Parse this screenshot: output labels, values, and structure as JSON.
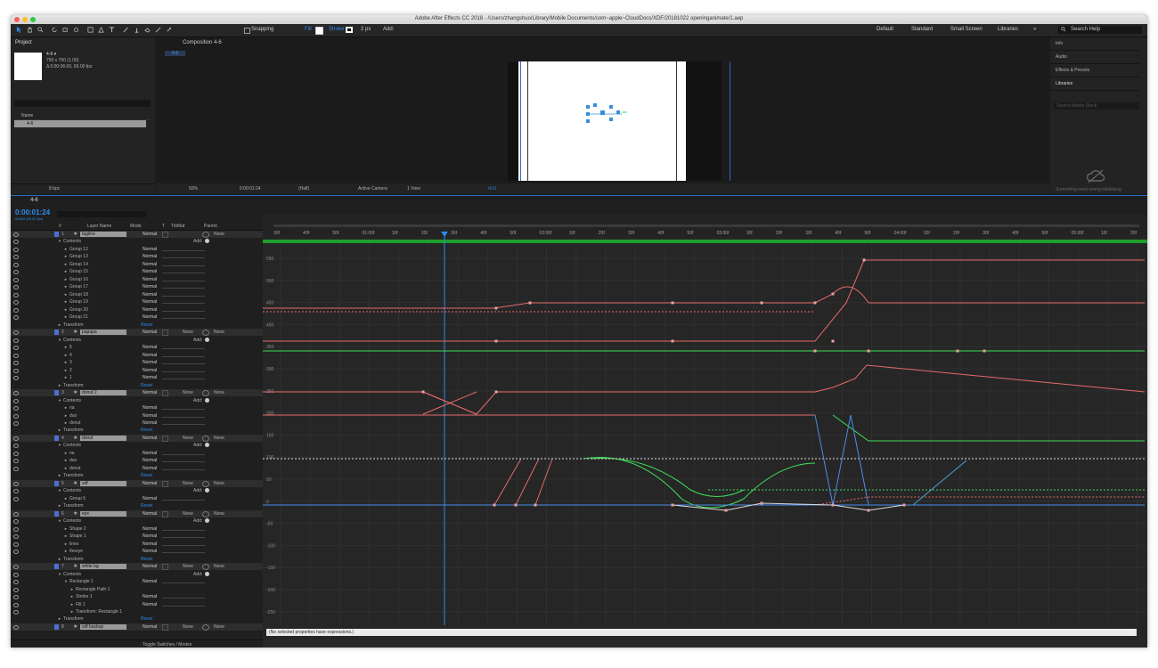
{
  "window": {
    "title": "Adobe After Effects CC 2018 - /Users/zhangshuo/Library/Mobile Documents/com~apple~CloudDocs/XDF/20181022 openinganimate/1.aep"
  },
  "toolbar": {
    "snapping": "Snapping",
    "fill": "Fill",
    "stroke": "Stroke",
    "stroke_width": "2 px",
    "add": "Add:",
    "workspaces": [
      "Default",
      "Standard",
      "Small Screen",
      "Libraries"
    ],
    "search_help": "Search Help"
  },
  "project": {
    "title": "Project",
    "item_name": "4-6 ▾",
    "item_dims": "750 x 750 (1.00)",
    "item_duration": "Δ 0:00:06:00, 60.00 fps",
    "name_header": "Name",
    "list_item": "4-6",
    "bpc": "8 bpc"
  },
  "composition": {
    "tab_label": "Composition 4-6",
    "chip": "4-6",
    "zoom": "50%",
    "timecode": "0:00:01:24",
    "resolution": "(Half)",
    "camera": "Active Camera",
    "view": "1 View",
    "offset": "+0.0"
  },
  "right_panels": [
    "Info",
    "Audio",
    "Effects & Presets",
    "Libraries"
  ],
  "libraries": {
    "search_placeholder": "Search Adobe Stock",
    "error_text": "Something went wrong initializing"
  },
  "timeline": {
    "tab": "4-6",
    "timecode": "0:00:01:24",
    "timecode_sub": "00084 (60.00 fps)",
    "headers": {
      "num": "#",
      "layer_name": "Layer Name",
      "mode": "Mode",
      "t": "T",
      "trkmat": "TrkMat",
      "parent": "Parent"
    },
    "ruler_labels": [
      "30f",
      "40f",
      "50f",
      "01:00f",
      "10f",
      "20f",
      "30f",
      "40f",
      "50f",
      "02:00f",
      "10f",
      "20f",
      "30f",
      "40f",
      "50f",
      "03:00f",
      "10f",
      "20f",
      "30f",
      "40f",
      "50f",
      "04:00f",
      "10f",
      "20f",
      "30f",
      "40f",
      "50f",
      "05:00f",
      "10f",
      "20f"
    ],
    "y_labels": [
      "550",
      "500",
      "450",
      "400",
      "350",
      "300",
      "250",
      "200",
      "150",
      "100",
      "50",
      "0",
      "-50",
      "-100",
      "-150",
      "-200",
      "-250"
    ],
    "expression_message": "(No selected properties have expressions.)",
    "toggle_label": "Toggle Switches / Modes"
  },
  "rows": [
    {
      "type": "layer",
      "num": "1",
      "name": "tagline",
      "mode": "Normal",
      "trkmat": "",
      "parent": "None"
    },
    {
      "type": "group",
      "indent": 1,
      "name": "Contents",
      "add": "Add:"
    },
    {
      "type": "prop",
      "indent": 2,
      "name": "Group 12",
      "mode": "Normal"
    },
    {
      "type": "prop",
      "indent": 2,
      "name": "Group 13",
      "mode": "Normal"
    },
    {
      "type": "prop",
      "indent": 2,
      "name": "Group 14",
      "mode": "Normal"
    },
    {
      "type": "prop",
      "indent": 2,
      "name": "Group 15",
      "mode": "Normal"
    },
    {
      "type": "prop",
      "indent": 2,
      "name": "Group 16",
      "mode": "Normal"
    },
    {
      "type": "prop",
      "indent": 2,
      "name": "Group 17",
      "mode": "Normal"
    },
    {
      "type": "prop",
      "indent": 2,
      "name": "Group 18",
      "mode": "Normal"
    },
    {
      "type": "prop",
      "indent": 2,
      "name": "Group 19",
      "mode": "Normal"
    },
    {
      "type": "prop",
      "indent": 2,
      "name": "Group 20",
      "mode": "Normal"
    },
    {
      "type": "prop",
      "indent": 2,
      "name": "Group 21",
      "mode": "Normal"
    },
    {
      "type": "transform",
      "indent": 1,
      "name": "Transform",
      "reset": "Reset"
    },
    {
      "type": "layer",
      "num": "2",
      "name": "papapa",
      "mode": "Normal",
      "trkmat": "None",
      "parent": "None"
    },
    {
      "type": "group",
      "indent": 1,
      "name": "Contents",
      "add": "Add:"
    },
    {
      "type": "prop",
      "indent": 2,
      "name": "5",
      "mode": "Normal"
    },
    {
      "type": "prop",
      "indent": 2,
      "name": "4",
      "mode": "Normal"
    },
    {
      "type": "prop",
      "indent": 2,
      "name": "3",
      "mode": "Normal"
    },
    {
      "type": "prop",
      "indent": 2,
      "name": "2",
      "mode": "Normal"
    },
    {
      "type": "prop",
      "indent": 2,
      "name": "1",
      "mode": "Normal"
    },
    {
      "type": "transform",
      "indent": 1,
      "name": "Transform",
      "reset": "Reset"
    },
    {
      "type": "layer",
      "num": "3",
      "name": "donut 2",
      "mode": "Normal",
      "trkmat": "None",
      "parent": "None"
    },
    {
      "type": "group",
      "indent": 1,
      "name": "Contents",
      "add": "Add:"
    },
    {
      "type": "prop",
      "indent": 2,
      "name": "na",
      "mode": "Normal"
    },
    {
      "type": "prop",
      "indent": 2,
      "name": "duo",
      "mode": "Normal"
    },
    {
      "type": "prop",
      "indent": 2,
      "name": "donut",
      "mode": "Normal"
    },
    {
      "type": "transform",
      "indent": 1,
      "name": "Transform",
      "reset": "Reset"
    },
    {
      "type": "layer",
      "num": "4",
      "name": "donut",
      "mode": "Normal",
      "trkmat": "None",
      "parent": "None"
    },
    {
      "type": "group",
      "indent": 1,
      "name": "Contents",
      "add": "Add:"
    },
    {
      "type": "prop",
      "indent": 2,
      "name": "na",
      "mode": "Normal"
    },
    {
      "type": "prop",
      "indent": 2,
      "name": "duo",
      "mode": "Normal"
    },
    {
      "type": "prop",
      "indent": 2,
      "name": "donut",
      "mode": "Normal"
    },
    {
      "type": "transform",
      "indent": 1,
      "name": "Transform",
      "reset": "Reset"
    },
    {
      "type": "layer",
      "num": "5",
      "name": "xdf",
      "mode": "Normal",
      "trkmat": "None",
      "parent": "None"
    },
    {
      "type": "group",
      "indent": 1,
      "name": "Contents",
      "add": "Add:"
    },
    {
      "type": "prop",
      "indent": 2,
      "name": "Group 5",
      "mode": "Normal"
    },
    {
      "type": "transform",
      "indent": 1,
      "name": "Transform",
      "reset": "Reset"
    },
    {
      "type": "layer",
      "num": "6",
      "name": "eye",
      "mode": "Normal",
      "trkmat": "None",
      "parent": "None"
    },
    {
      "type": "group",
      "indent": 1,
      "name": "Contents",
      "add": "Add:"
    },
    {
      "type": "prop",
      "indent": 2,
      "name": "Shape 2",
      "mode": "Normal"
    },
    {
      "type": "prop",
      "indent": 2,
      "name": "Shape 1",
      "mode": "Normal"
    },
    {
      "type": "prop",
      "indent": 2,
      "name": "lines",
      "mode": "Normal"
    },
    {
      "type": "prop",
      "indent": 2,
      "name": "theeye",
      "mode": "Normal"
    },
    {
      "type": "transform",
      "indent": 1,
      "name": "Transform",
      "reset": "Reset"
    },
    {
      "type": "layer",
      "num": "7",
      "name": "white bg",
      "mode": "Normal",
      "trkmat": "None",
      "parent": "None"
    },
    {
      "type": "group",
      "indent": 1,
      "name": "Contents",
      "add": "Add:"
    },
    {
      "type": "group",
      "indent": 2,
      "name": "Rectangle 1",
      "mode": "Normal"
    },
    {
      "type": "prop",
      "indent": 3,
      "name": "Rectangle Path 1"
    },
    {
      "type": "prop",
      "indent": 3,
      "name": "Stroke 1",
      "mode": "Normal"
    },
    {
      "type": "prop",
      "indent": 3,
      "name": "Fill 1",
      "mode": "Normal"
    },
    {
      "type": "prop",
      "indent": 3,
      "name": "Transform: Rectangle 1"
    },
    {
      "type": "transform",
      "indent": 1,
      "name": "Transform",
      "reset": "Reset"
    },
    {
      "type": "layer",
      "num": "8",
      "name": "xdf backup",
      "mode": "Normal",
      "trkmat": "None",
      "parent": "None"
    }
  ],
  "colors": {
    "accent": "#2d8ceb",
    "red_curve": "#e66a6a",
    "green_curve": "#3fdc5a",
    "blue_curve": "#4a8ee8",
    "bg": "#1d1d1d"
  }
}
